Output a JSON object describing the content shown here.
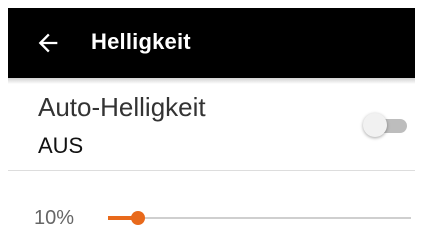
{
  "app_bar": {
    "title": "Helligkeit",
    "back_icon": "arrow-left-icon",
    "background": "#000000"
  },
  "auto_brightness": {
    "label": "Auto-Helligkeit",
    "state_text": "AUS",
    "enabled": false
  },
  "brightness": {
    "value_text": "10%",
    "level": 0.1,
    "accent_color": "#e8691b"
  }
}
